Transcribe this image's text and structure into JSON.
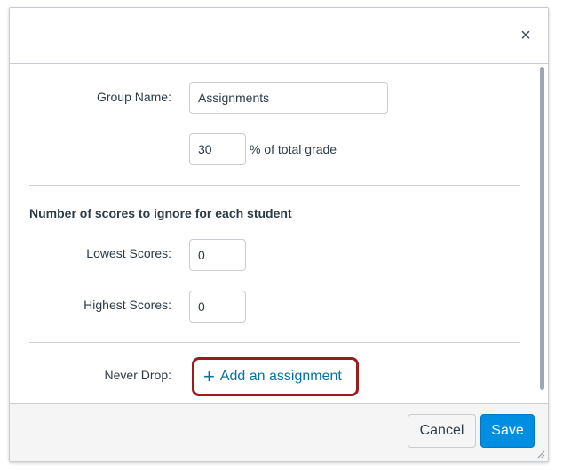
{
  "dialog": {
    "close_icon": "close-icon",
    "close_glyph": "×"
  },
  "form": {
    "group_name_label": "Group Name:",
    "group_name_value": "Assignments",
    "weight_value": "30",
    "weight_suffix": "% of total grade",
    "scores_section_title": "Number of scores to ignore for each student",
    "lowest_label": "Lowest Scores:",
    "lowest_value": "0",
    "highest_label": "Highest Scores:",
    "highest_value": "0",
    "never_drop_label": "Never Drop:",
    "add_assignment_label": "Add an assignment",
    "add_icon": "plus-icon",
    "plus_glyph": "+"
  },
  "footer": {
    "cancel_label": "Cancel",
    "save_label": "Save"
  },
  "colors": {
    "link": "#0770a3",
    "primary": "#008ee2",
    "highlight": "#9b1c1c"
  }
}
